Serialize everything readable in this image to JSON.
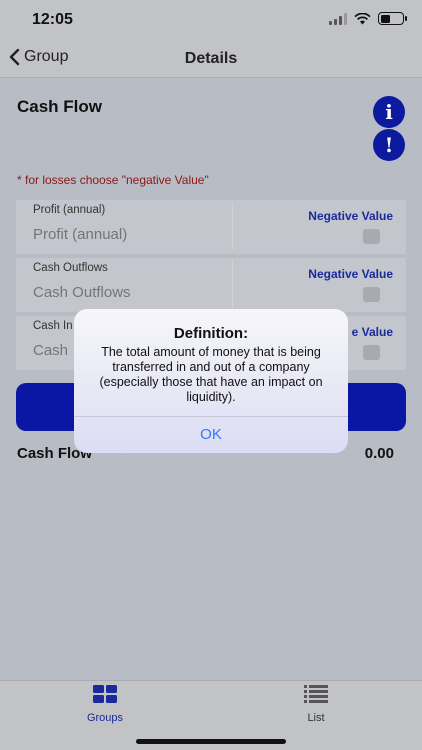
{
  "status_bar": {
    "time": "12:05"
  },
  "nav": {
    "back_label": "Group",
    "title": "Details"
  },
  "page": {
    "title": "Cash Flow",
    "info_icon_glyph": "i",
    "alert_icon_glyph": "!",
    "hint": "* for losses choose \"negative Value\""
  },
  "fields": [
    {
      "label": "Profit (annual)",
      "placeholder": "Profit (annual)",
      "negative_label": "Negative Value"
    },
    {
      "label": "Cash Outflows",
      "placeholder": "Cash Outflows",
      "negative_label": "Negative Value"
    },
    {
      "label": "Cash In",
      "placeholder": "Cash",
      "negative_label": "e Value"
    }
  ],
  "result": {
    "label": "Cash Flow",
    "value": "0.00"
  },
  "alert": {
    "title": "Definition:",
    "message": "The total amount of money that is being transferred in and out of a company (especially those that have an impact on liquidity).",
    "ok_label": "OK"
  },
  "tabs": [
    {
      "label": "Groups",
      "icon": "grid-icon",
      "active": true
    },
    {
      "label": "List",
      "icon": "list-icon",
      "active": false
    }
  ],
  "colors": {
    "accent": "#0a17a4",
    "hint": "#8a1818",
    "link": "#3478f6"
  }
}
